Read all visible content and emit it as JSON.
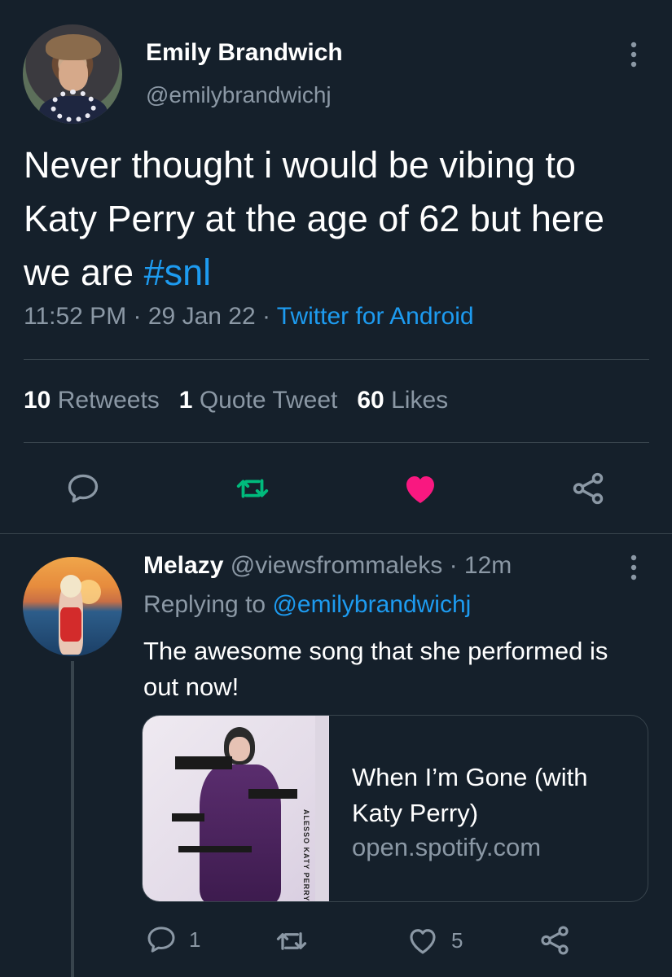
{
  "tweet": {
    "author_name": "Emily Brandwich",
    "author_handle": "@emilybrandwichj",
    "text_before": "Never thought i would be vibing to Katy Perry at the age of 62 but here we are ",
    "hashtag": "#snl",
    "time": "11:52 PM",
    "date": "29 Jan 22",
    "source": "Twitter for Android",
    "separator": "·"
  },
  "stats": {
    "retweets_count": "10",
    "retweets_label": "Retweets",
    "quotes_count": "1",
    "quotes_label": "Quote Tweet",
    "likes_count": "60",
    "likes_label": "Likes"
  },
  "actions": {
    "reply_icon": "reply-icon",
    "retweet_icon": "retweet-icon",
    "like_icon": "heart-icon",
    "share_icon": "share-icon",
    "retweet_color": "#00ba7c",
    "like_color": "#f91880"
  },
  "reply": {
    "author_name": "Melazy",
    "author_handle": "@viewsfrommaleks",
    "time_ago": "12m",
    "separator": "·",
    "replying_prefix": "Replying to",
    "replying_to": "@emilybrandwichj",
    "text": "The awesome song that she performed is out now!",
    "card": {
      "title": "When I’m Gone (with Katy Perry)",
      "domain": "open.spotify.com",
      "cover_text": "ALESSO KATY PERRY WHEN I'M GONE"
    },
    "reply_count": "1",
    "retweet_count": "",
    "like_count": "5"
  },
  "colors": {
    "background": "#15202b",
    "divider": "#38444d",
    "secondary_text": "#8b98a5",
    "accent": "#1d9bf0"
  }
}
